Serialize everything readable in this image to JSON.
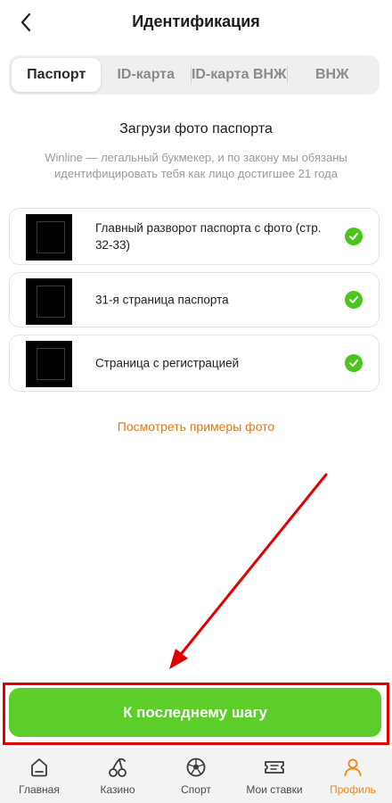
{
  "header": {
    "title": "Идентификация"
  },
  "tabs": [
    {
      "label": "Паспорт",
      "active": true
    },
    {
      "label": "ID-карта",
      "active": false
    },
    {
      "label": "ID-карта ВНЖ",
      "active": false
    },
    {
      "label": "ВНЖ",
      "active": false
    }
  ],
  "upload": {
    "title": "Загрузи фото паспорта",
    "description": "Winline — легальный букмекер, и по закону мы обязаны идентифицировать тебя как лицо достигшее 21 года"
  },
  "documents": [
    {
      "label": "Главный разворот паспорта с фото (стр. 32-33)",
      "status": "uploaded"
    },
    {
      "label": "31-я страница паспорта",
      "status": "uploaded"
    },
    {
      "label": "Страница с регистрацией",
      "status": "uploaded"
    }
  ],
  "examples_link": "Посмотреть примеры фото",
  "cta": {
    "label": "К последнему шагу"
  },
  "bottom_nav": [
    {
      "label": "Главная",
      "icon": "home-icon",
      "active": false
    },
    {
      "label": "Казино",
      "icon": "cherries-icon",
      "active": false
    },
    {
      "label": "Спорт",
      "icon": "ball-icon",
      "active": false
    },
    {
      "label": "Мои ставки",
      "icon": "ticket-icon",
      "active": false
    },
    {
      "label": "Профиль",
      "icon": "profile-icon",
      "active": true
    }
  ],
  "colors": {
    "accent_green": "#5ccd2a",
    "check_green": "#4bc41e",
    "link_orange": "#e07a16",
    "active_nav": "#f08a1c",
    "highlight_red": "#e00000"
  }
}
